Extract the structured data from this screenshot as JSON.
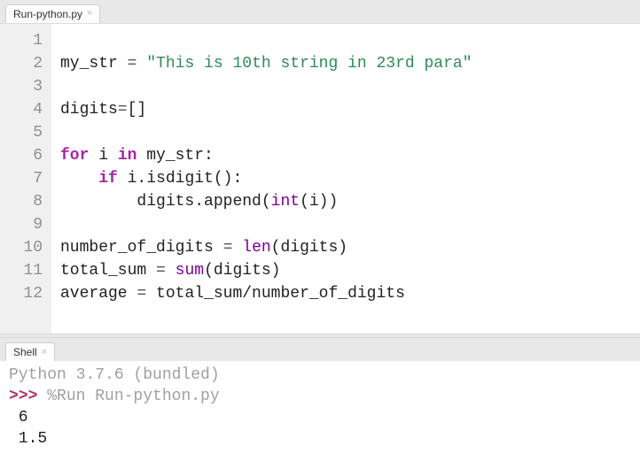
{
  "editor": {
    "tab": {
      "label": "Run-python.py"
    },
    "lines": {
      "l1": "1",
      "l2": "2",
      "l3": "3",
      "l4": "4",
      "l5": "5",
      "l6": "6",
      "l7": "7",
      "l8": "8",
      "l9": "9",
      "l10": "10",
      "l11": "11",
      "l12": "12"
    },
    "code": {
      "line1": {
        "a": "my_str ",
        "op1": "=",
        "sp": " ",
        "str": "\"This is 10th string in 23rd para\""
      },
      "line2": "",
      "line3": {
        "a": "digits",
        "op1": "=",
        "b": "[]"
      },
      "line4": "",
      "line5": {
        "kw1": "for",
        "a": " i ",
        "kw2": "in",
        "b": " my_str:"
      },
      "line6": {
        "indent": "    ",
        "kw1": "if",
        "a": " i.isdigit():"
      },
      "line7": {
        "indent": "        ",
        "a": "digits.append(",
        "bi": "int",
        "b": "(i))"
      },
      "line8": "",
      "line9": {
        "a": "number_of_digits ",
        "op": "=",
        "sp": " ",
        "bi": "len",
        "b": "(digits)"
      },
      "line10": {
        "a": "total_sum ",
        "op": "=",
        "sp": " ",
        "bi": "sum",
        "b": "(digits)"
      },
      "line11": {
        "a": "average ",
        "op": "=",
        "b": " total_sum/number_of_digits"
      },
      "line12": ""
    }
  },
  "shell": {
    "tab": {
      "label": "Shell"
    },
    "version": "Python 3.7.6 (bundled)",
    "prompt": ">>> ",
    "command": "%Run Run-python.py",
    "output": {
      "line1": " 6",
      "line2": " 1.5"
    }
  }
}
